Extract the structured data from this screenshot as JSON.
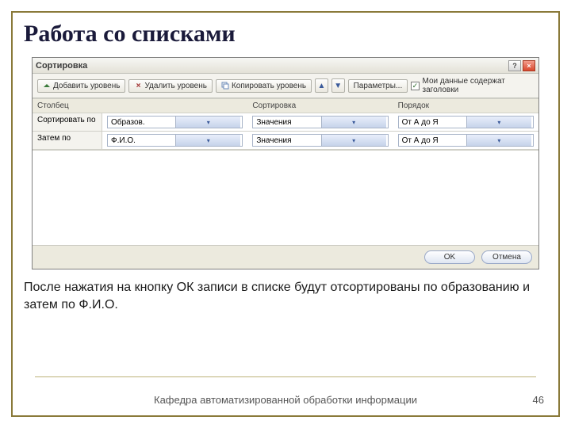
{
  "title": "Работа со списками",
  "dialog": {
    "caption": "Сортировка",
    "toolbar": {
      "add": "Добавить уровень",
      "del": "Удалить уровень",
      "copy": "Копировать уровень",
      "params": "Параметры...",
      "checkbox": "Мои данные содержат заголовки"
    },
    "headers": {
      "col": "Столбец",
      "sort_by": "Сортировка",
      "order": "Порядок"
    },
    "rows": [
      {
        "lead": "Сортировать по",
        "col": "Образов.",
        "by": "Значения",
        "order": "От А до Я"
      },
      {
        "lead": "Затем по",
        "col": "Ф.И.О.",
        "by": "Значения",
        "order": "От А до Я"
      }
    ],
    "ok": "OK",
    "cancel": "Отмена"
  },
  "body_text": "После нажатия на кнопку ОК записи в списке будут отсортированы по образованию и затем по Ф.И.О.",
  "footer": "Кафедра автоматизированной обработки информации",
  "page": "46"
}
